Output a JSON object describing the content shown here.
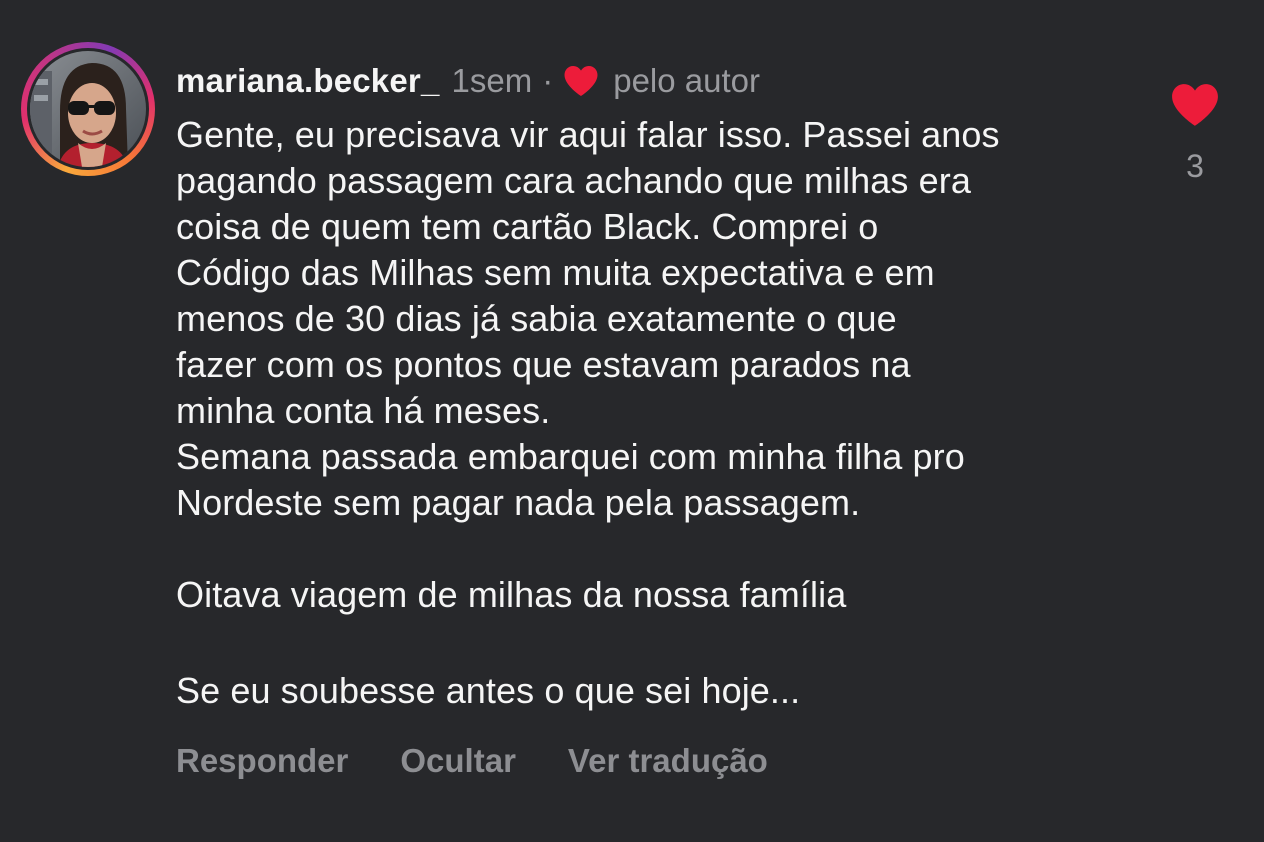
{
  "comment": {
    "username": "mariana.becker_",
    "time": "1sem",
    "separator": "·",
    "liked_by_author": "pelo autor",
    "paragraphs": [
      "Gente, eu precisava vir aqui falar isso. Passei anos\npagando passagem cara achando que milhas era\ncoisa de quem tem cartão Black. Comprei o\nCódigo das Milhas sem muita expectativa e em\nmenos de 30 dias já sabia exatamente o que\nfazer com os pontos que estavam parados na\nminha conta há meses.\nSemana passada embarquei com minha filha pro\nNordeste sem pagar nada pela passagem.",
      "Oitava viagem de milhas da nossa família",
      "Se eu soubesse antes o que sei hoje..."
    ],
    "like_count": "3",
    "actions": {
      "reply": "Responder",
      "hide": "Ocultar",
      "translate": "Ver tradução"
    }
  },
  "colors": {
    "background": "#27282b",
    "heart": "#ed1c3a",
    "muted_text": "#9a9b9f"
  },
  "icons": {
    "author_like": "heart-icon",
    "like": "heart-icon"
  }
}
